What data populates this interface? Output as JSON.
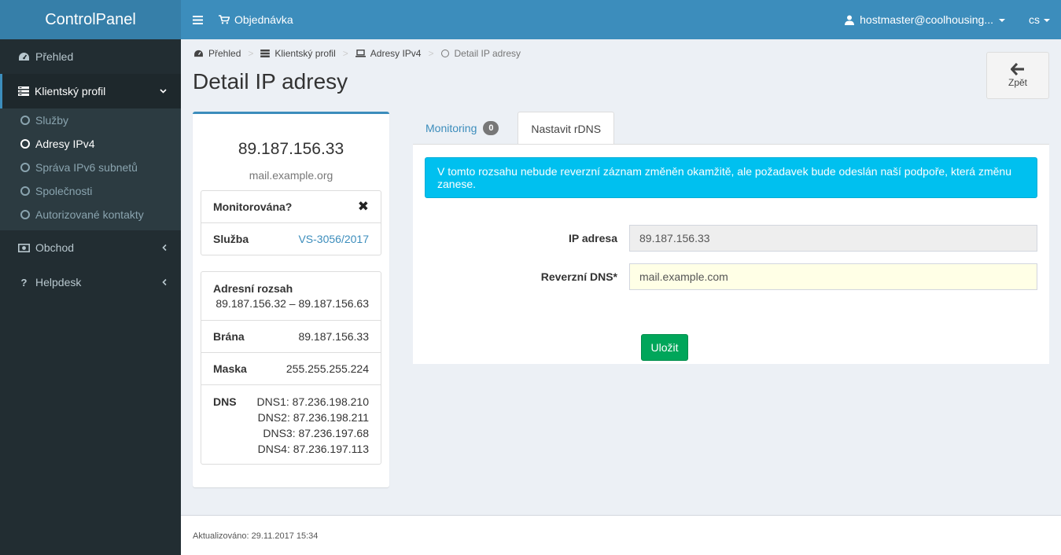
{
  "brand": "ControlPanel",
  "navbar": {
    "order_label": "Objednávka",
    "user_label": "hostmaster@coolhousing...",
    "lang_label": "cs"
  },
  "sidebar": {
    "items": [
      {
        "label": "Přehled",
        "icon": "dashboard-icon"
      },
      {
        "label": "Klientský profil",
        "icon": "server-icon"
      },
      {
        "label": "Obchod",
        "icon": "money-icon"
      },
      {
        "label": "Helpdesk",
        "icon": "question-icon"
      }
    ],
    "submenu": [
      {
        "label": "Služby"
      },
      {
        "label": "Adresy IPv4"
      },
      {
        "label": "Správa IPv6 subnetů"
      },
      {
        "label": "Společnosti"
      },
      {
        "label": "Autorizované kontakty"
      }
    ]
  },
  "breadcrumb": [
    "Přehled",
    "Klientský profil",
    "Adresy IPv4",
    "Detail IP adresy"
  ],
  "page_title": "Detail IP adresy",
  "back_button": "Zpět",
  "ip_card": {
    "ip": "89.187.156.33",
    "hostname": "mail.example.org",
    "monitored_label": "Monitorována?",
    "service_label": "Služba",
    "service_value": "VS-3056/2017",
    "range_label": "Adresní rozsah",
    "range_value": "89.187.156.32 – 89.187.156.63",
    "gateway_label": "Brána",
    "gateway_value": "89.187.156.33",
    "mask_label": "Maska",
    "mask_value": "255.255.255.224",
    "dns_label": "DNS",
    "dns_values": [
      "DNS1: 87.236.198.210",
      "DNS2: 87.236.198.211",
      "DNS3: 87.236.197.68",
      "DNS4: 87.236.197.113"
    ]
  },
  "tabs": {
    "monitoring_label": "Monitoring",
    "monitoring_count": "0",
    "rdns_label": "Nastavit rDNS"
  },
  "rdns_form": {
    "info": "V tomto rozsahu nebude reverzní záznam změněn okamžitě, ale požadavek bude odeslán naší podpoře, která změnu zanese.",
    "ip_label": "IP adresa",
    "ip_value": "89.187.156.33",
    "dns_label": "Reverzní DNS*",
    "dns_value": "mail.example.com",
    "save_label": "Uložit"
  },
  "footer": "Aktualizováno: 29.11.2017 15:34",
  "colors": {
    "navbar": "#3c8dbc",
    "logo_bg": "#367fa9",
    "sidebar": "#222d32",
    "info_callout": "#00c0ef",
    "save_button": "#00a65a"
  }
}
